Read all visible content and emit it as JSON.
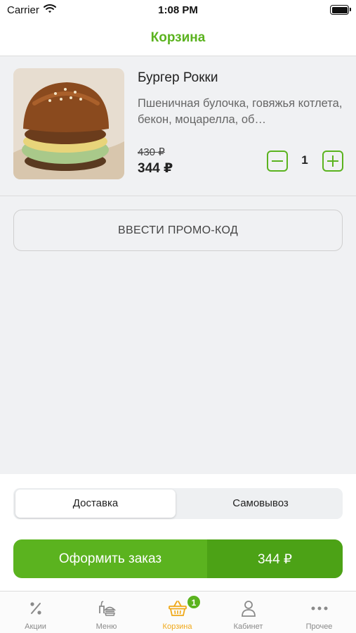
{
  "status_bar": {
    "carrier": "Carrier",
    "time": "1:08 PM"
  },
  "nav": {
    "title": "Корзина"
  },
  "cart_items": [
    {
      "name": "Бургер Рокки",
      "description": "Пшеничная булочка, говяжья котлета, бекон, моцарелла, об…",
      "old_price": "430 ₽",
      "price": "344 ₽",
      "quantity": "1"
    }
  ],
  "promo": {
    "label": "ВВЕСТИ ПРОМО-КОД"
  },
  "delivery_options": {
    "delivery": "Доставка",
    "pickup": "Самовывоз",
    "selected": "delivery"
  },
  "order": {
    "label": "Оформить заказ",
    "total": "344 ₽"
  },
  "tabs": [
    {
      "label": "Акции",
      "icon": "percent-icon"
    },
    {
      "label": "Меню",
      "icon": "menu-food-icon"
    },
    {
      "label": "Корзина",
      "icon": "basket-icon",
      "badge": "1",
      "active": true
    },
    {
      "label": "Кабинет",
      "icon": "user-icon"
    },
    {
      "label": "Прочее",
      "icon": "more-icon"
    }
  ],
  "colors": {
    "accent": "#5bb31f",
    "accent_dark": "#4ca216",
    "active_tab": "#f0a818"
  }
}
